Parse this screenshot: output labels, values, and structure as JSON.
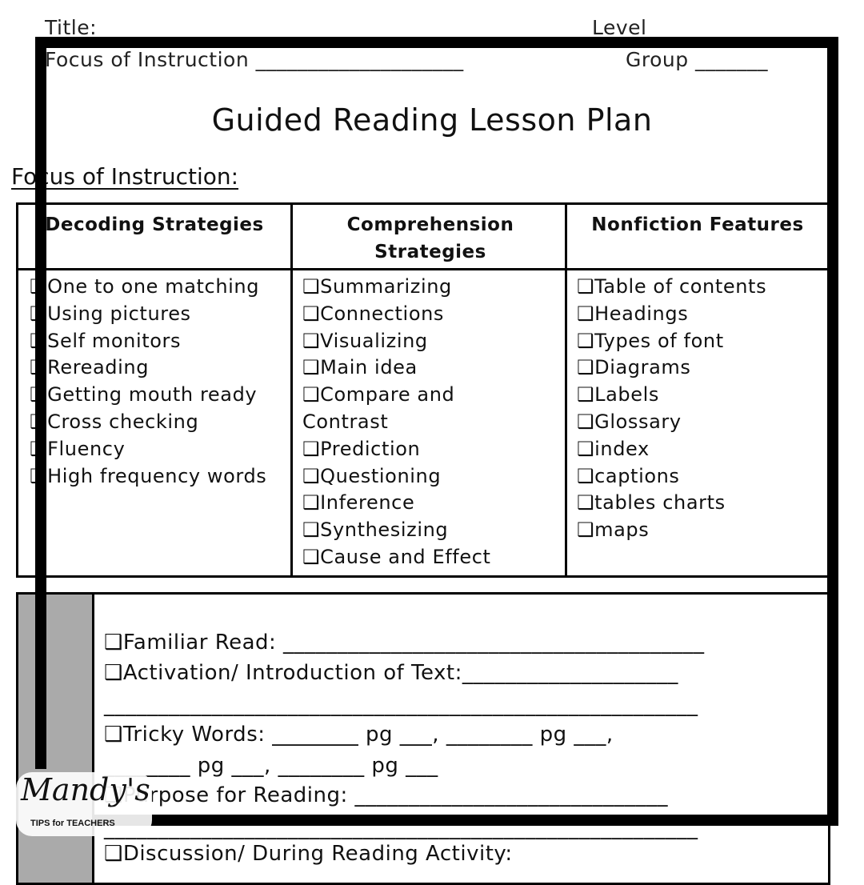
{
  "header": {
    "title_label": "Title:",
    "level_label": "Level",
    "focus_label": "Focus of Instruction ____________________",
    "group_label": "Group _______"
  },
  "page_title": "Guided Reading Lesson Plan",
  "focus_heading": "Focus of Instruction:",
  "table": {
    "columns": [
      {
        "heading": "Decoding Strategies",
        "items": [
          "One to one matching",
          "Using pictures",
          "Self monitors",
          "Rereading",
          "Getting mouth ready",
          "Cross checking",
          "Fluency",
          "High frequency words"
        ]
      },
      {
        "heading": "Comprehension Strategies",
        "items": [
          "Summarizing",
          "Connections",
          "Visualizing",
          "Main idea",
          "Compare and",
          "Contrast",
          "Prediction",
          "Questioning",
          "Inference",
          "Synthesizing",
          "Cause and Effect"
        ]
      },
      {
        "heading": "Nonfiction Features",
        "items": [
          "Table of contents",
          "Headings",
          "Types of font",
          "Diagrams",
          "Labels",
          "Glossary",
          "index",
          "captions",
          "tables charts",
          "maps"
        ]
      }
    ]
  },
  "lesson": {
    "familiar_read": "Familiar Read: _______________________________________",
    "activation": "Activation/ Introduction of Text:____________________",
    "activation_line2": "_______________________________________________________",
    "tricky_words": "Tricky Words: ________ pg ___, ________ pg ___,",
    "tricky_words_2": "________ pg ___, ________ pg ___",
    "purpose": "Purpose for Reading: _____________________________",
    "purpose_line2": "_______________________________________________________",
    "discussion": "Discussion/ During Reading Activity:"
  },
  "checkbox_glyph": "❑",
  "logo": {
    "name": "Mandy's",
    "tagline": "TIPS for TEACHERS"
  }
}
